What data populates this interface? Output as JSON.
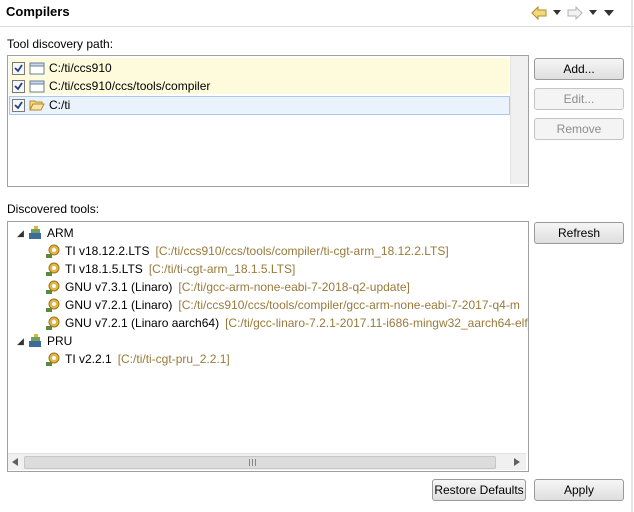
{
  "header": {
    "title": "Compilers"
  },
  "discovery": {
    "label": "Tool discovery path:",
    "paths": [
      {
        "label": "C:/ti/ccs910",
        "checked": true
      },
      {
        "label": "C:/ti/ccs910/ccs/tools/compiler",
        "checked": true
      },
      {
        "label": "C:/ti",
        "checked": true
      }
    ],
    "buttons": {
      "add": "Add...",
      "edit": "Edit...",
      "remove": "Remove"
    }
  },
  "discovered": {
    "label": "Discovered tools:",
    "refresh": "Refresh",
    "groups": [
      {
        "name": "ARM",
        "tools": [
          {
            "name": "TI v18.12.2.LTS",
            "path": "[C:/ti/ccs910/ccs/tools/compiler/ti-cgt-arm_18.12.2.LTS]"
          },
          {
            "name": "TI v18.1.5.LTS",
            "path": "[C:/ti/ti-cgt-arm_18.1.5.LTS]"
          },
          {
            "name": "GNU v7.3.1 (Linaro)",
            "path": "[C:/ti/gcc-arm-none-eabi-7-2018-q2-update]"
          },
          {
            "name": "GNU v7.2.1 (Linaro)",
            "path": "[C:/ti/ccs910/ccs/tools/compiler/gcc-arm-none-eabi-7-2017-q4-m"
          },
          {
            "name": "GNU v7.2.1 (Linaro aarch64)",
            "path": "[C:/ti/gcc-linaro-7.2.1-2017.11-i686-mingw32_aarch64-elf]"
          }
        ]
      },
      {
        "name": "PRU",
        "tools": [
          {
            "name": "TI v2.2.1",
            "path": "[C:/ti/ti-cgt-pru_2.2.1]"
          }
        ]
      }
    ]
  },
  "footer": {
    "restore": "Restore Defaults",
    "apply": "Apply"
  },
  "colors": {
    "selected_row": "#fdfbdc",
    "focus_row": "#eaf3fc",
    "path_text": "#9a7a3a"
  }
}
